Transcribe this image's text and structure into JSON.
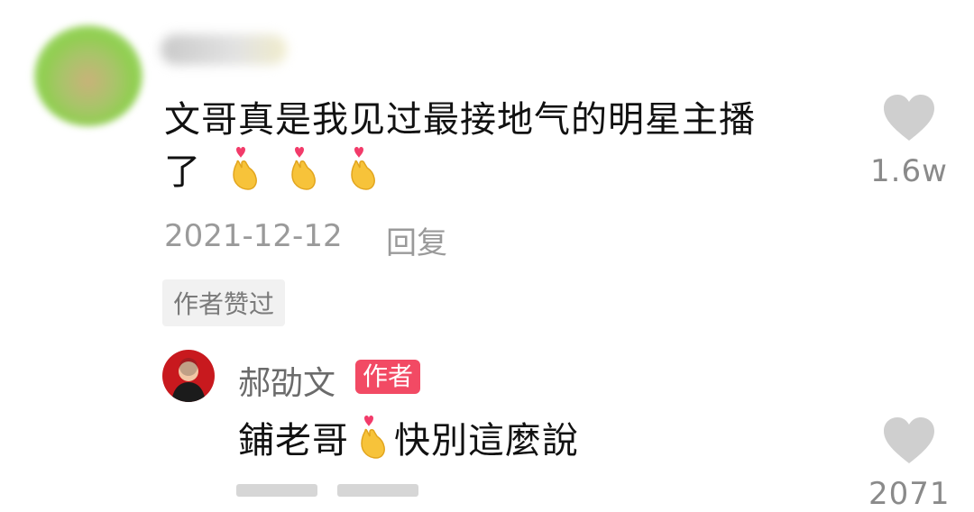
{
  "comment": {
    "text_line1": "文哥真是我见过最接地气的明星主播",
    "text_line2_prefix": "了",
    "emoji": "finger-heart-icon",
    "date": "2021-12-12",
    "reply_label": "回复",
    "author_liked_label": "作者赞过",
    "like_count": "1.6w"
  },
  "reply": {
    "username": "郝劭文",
    "author_badge": "作者",
    "text_part1": "鋪老哥",
    "text_part2": "快別這麼說",
    "emoji": "finger-heart-icon",
    "like_count": "2071"
  },
  "colors": {
    "badge_pink": "#f24a64",
    "meta_gray": "#9a9a9a",
    "heart_gray": "#cfcfcf"
  }
}
